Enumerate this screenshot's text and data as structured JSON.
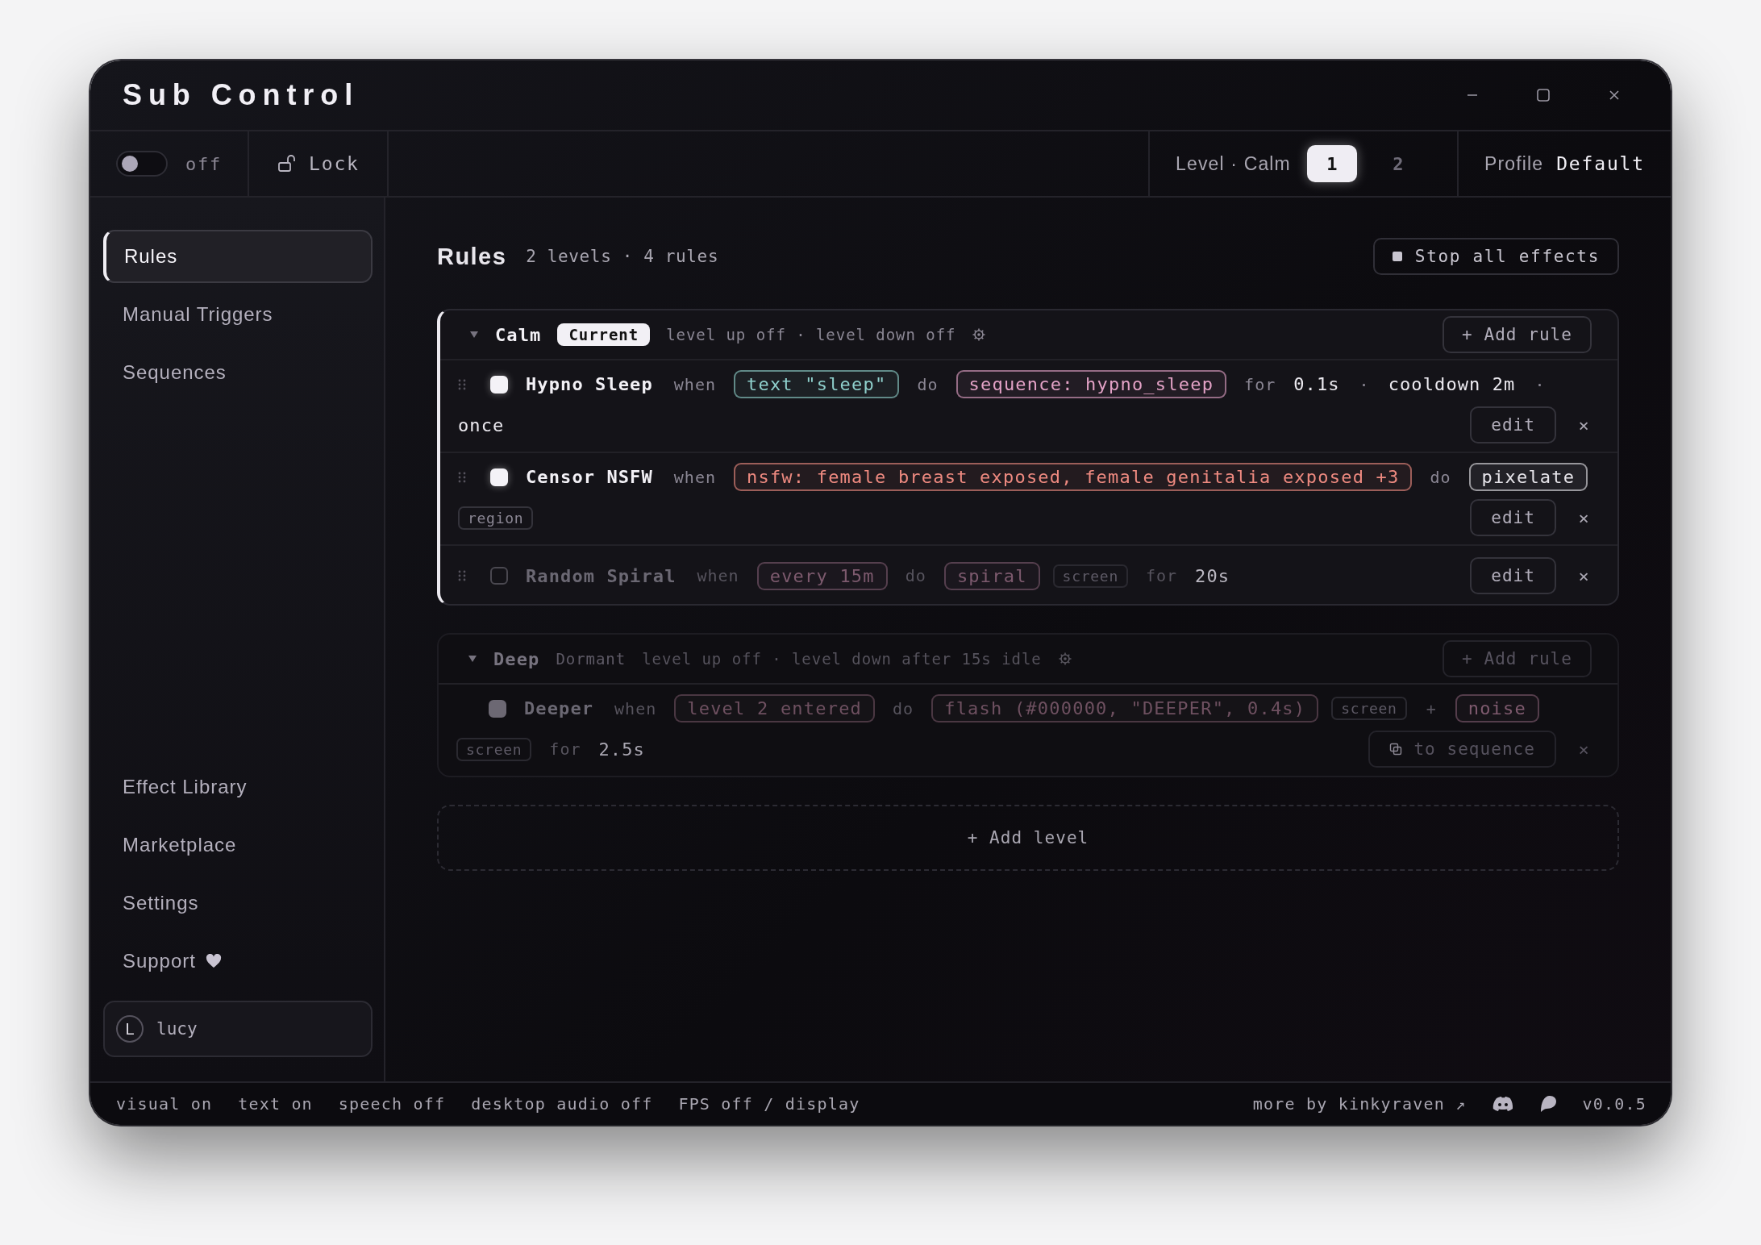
{
  "window": {
    "title": "Sub Control"
  },
  "toolbar": {
    "toggle": {
      "on": false,
      "label": "off"
    },
    "lock": {
      "locked": false,
      "label": "Lock"
    },
    "level": {
      "label": "Level · Calm",
      "options": [
        {
          "label": "1",
          "selected": true
        },
        {
          "label": "2",
          "selected": false
        }
      ]
    },
    "profile": {
      "label": "Profile",
      "value": "Default"
    }
  },
  "sidebar": {
    "items": [
      {
        "label": "Rules",
        "selected": true
      },
      {
        "label": "Manual Triggers",
        "selected": false
      },
      {
        "label": "Sequences",
        "selected": false
      }
    ],
    "bottom_items": [
      {
        "label": "Effect Library",
        "selected": false,
        "kind": "page"
      },
      {
        "label": "Marketplace",
        "selected": false,
        "kind": "page"
      },
      {
        "label": "Settings",
        "selected": false,
        "kind": "page"
      },
      {
        "label": "Support",
        "selected": false,
        "kind": "support"
      }
    ],
    "user": {
      "initial": "L",
      "name": "lucy"
    }
  },
  "main": {
    "title": "Rules",
    "summary": "2 levels · 4 rules",
    "stop_button": "Stop all effects",
    "levels": [
      {
        "name": "Calm",
        "active": true,
        "expanded": true,
        "badge": "Current",
        "settings": "level up off · level down off",
        "add_button": "+ Add rule",
        "rules": [
          {
            "name": "Hypno Sleep",
            "enabled": true,
            "parts": [
              {
                "kind": "word",
                "text": "when"
              },
              {
                "kind": "pill",
                "text": "text \"sleep\"",
                "color": "#8fd0cc"
              },
              {
                "kind": "word",
                "text": "do"
              },
              {
                "kind": "pill",
                "text": "sequence: hypno_sleep",
                "color": "#e3a2c6"
              },
              {
                "kind": "word",
                "text": "for"
              },
              {
                "kind": "value",
                "text": "0.1s"
              },
              {
                "kind": "sep",
                "text": "·"
              },
              {
                "kind": "value",
                "text": "cooldown 2m"
              },
              {
                "kind": "sep",
                "text": "·"
              },
              {
                "kind": "value",
                "text": "once"
              }
            ],
            "buttons": [
              {
                "kind": "edit",
                "label": "edit"
              }
            ],
            "close": "×"
          },
          {
            "name": "Censor NSFW",
            "enabled": true,
            "parts": [
              {
                "kind": "word",
                "text": "when"
              },
              {
                "kind": "pill",
                "text": "nsfw: female breast exposed, female genitalia exposed +3",
                "color": "#ee8a80"
              },
              {
                "kind": "word",
                "text": "do"
              },
              {
                "kind": "pill",
                "text": "pixelate",
                "color": "#e6e4ea"
              },
              {
                "kind": "tag",
                "text": "region"
              }
            ],
            "buttons": [
              {
                "kind": "edit",
                "label": "edit"
              }
            ],
            "close": "×"
          },
          {
            "name": "Random Spiral",
            "enabled": false,
            "parts": [
              {
                "kind": "word",
                "text": "when"
              },
              {
                "kind": "pill",
                "text": "every 15m",
                "color": "#7d5a6e"
              },
              {
                "kind": "word",
                "text": "do"
              },
              {
                "kind": "pill",
                "text": "spiral",
                "color": "#7d5a6e"
              },
              {
                "kind": "tag",
                "text": "screen"
              },
              {
                "kind": "word",
                "text": "for"
              },
              {
                "kind": "value",
                "text": "20s"
              }
            ],
            "buttons": [
              {
                "kind": "edit",
                "label": "edit"
              }
            ],
            "close": "×"
          }
        ]
      },
      {
        "name": "Deep",
        "active": false,
        "expanded": true,
        "badge": "Dormant",
        "settings": "level up off · level down after 15s idle",
        "add_button": "+ Add rule",
        "rules": [
          {
            "name": "Deeper",
            "enabled": true,
            "parts": [
              {
                "kind": "word",
                "text": "when"
              },
              {
                "kind": "pill",
                "text": "level 2 entered",
                "color": "#6e5060"
              },
              {
                "kind": "word",
                "text": "do"
              },
              {
                "kind": "pill",
                "text": "flash (#000000, \"DEEPER\", 0.4s)",
                "color": "#6e5060"
              },
              {
                "kind": "tag",
                "text": "screen"
              },
              {
                "kind": "sep",
                "text": "+"
              },
              {
                "kind": "pill",
                "text": "noise",
                "color": "#7e5a6e"
              },
              {
                "kind": "tag",
                "text": "screen"
              },
              {
                "kind": "word",
                "text": "for"
              },
              {
                "kind": "value",
                "text": "2.5s"
              }
            ],
            "buttons": [
              {
                "kind": "convert",
                "label": "to sequence"
              }
            ],
            "close": "×"
          }
        ]
      }
    ],
    "add_level": "+ Add level"
  },
  "status_bar": {
    "items": [
      "visual on",
      "text on",
      "speech off",
      "desktop audio off",
      "FPS off / display"
    ],
    "link": "more by kinkyraven ↗",
    "version": "v0.0.5"
  }
}
